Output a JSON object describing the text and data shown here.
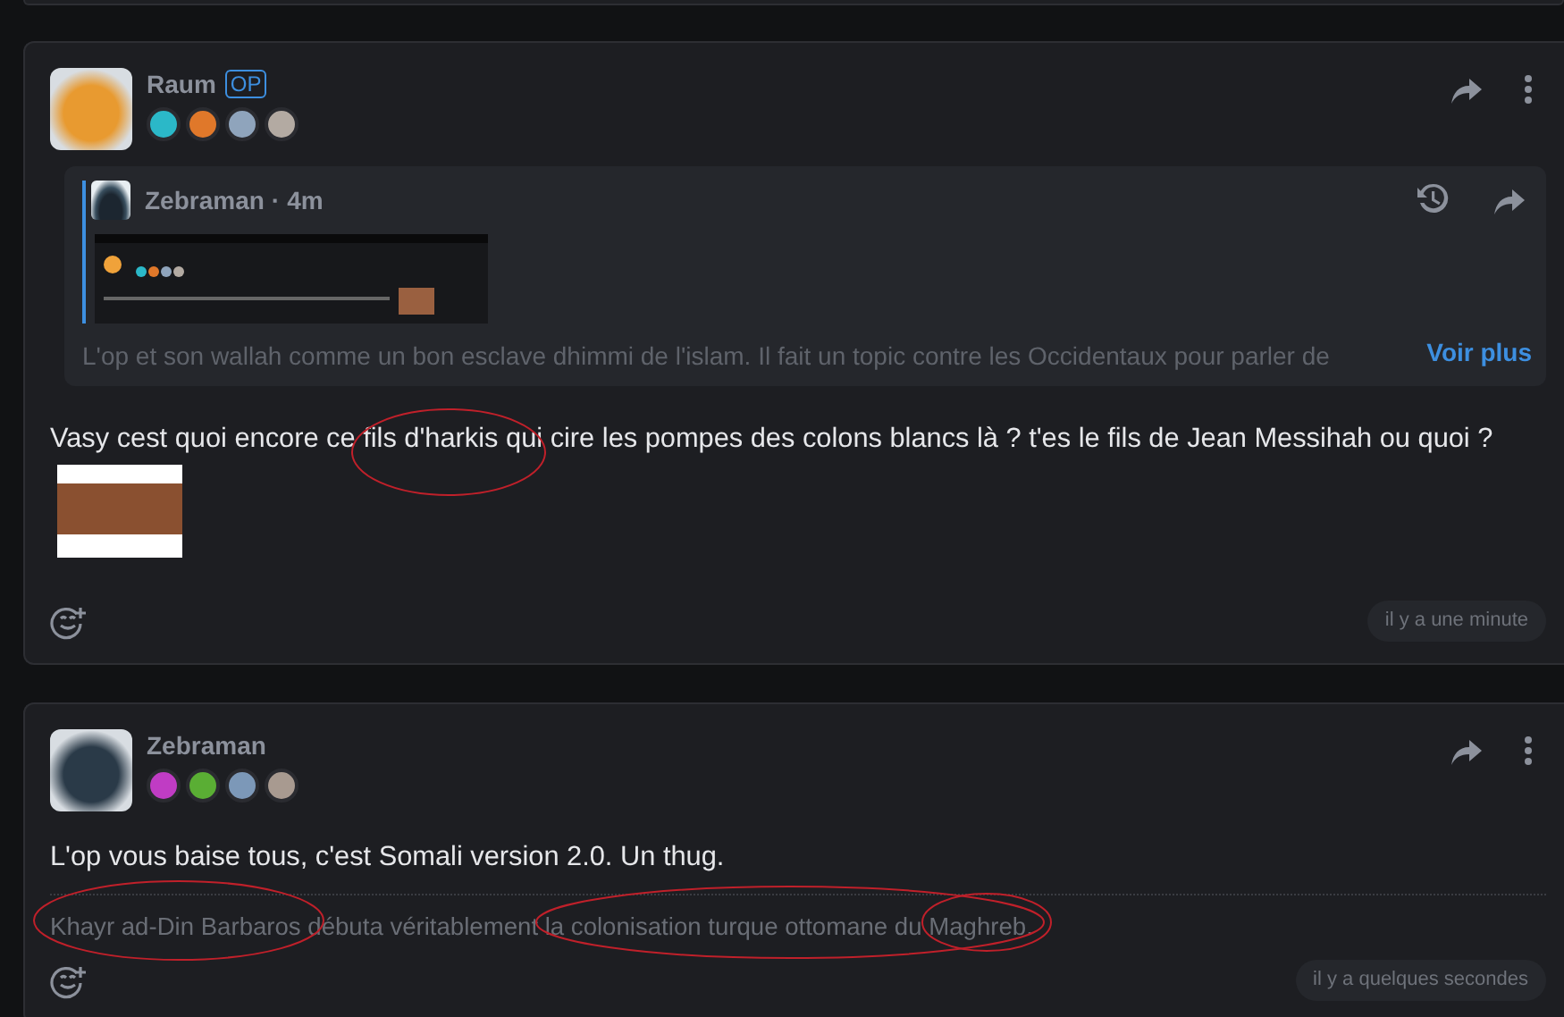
{
  "posts": [
    {
      "author": "Raum",
      "op_label": "OP",
      "avatar": {
        "color": "#e89a30"
      },
      "badges": [
        {
          "color": "#2bb8c8"
        },
        {
          "color": "#e0782a"
        },
        {
          "color": "#8fa4bc"
        },
        {
          "color": "#b3aaa2"
        }
      ],
      "quote": {
        "author": "Zebraman",
        "separator": "·",
        "age": "4m",
        "excerpt": "L'op et son wallah comme un bon esclave dhimmi de l'islam. Il fait un topic contre les Occidentaux pour parler de",
        "more": "Voir plus"
      },
      "text": "Vasy cest quoi encore ce fils d'harkis qui cire les pompes des colons blancs là ? t'es le fils de Jean Messihah ou quoi ?",
      "attachments": [
        {
          "kind": "photo"
        }
      ],
      "time": "il y a une minute"
    },
    {
      "author": "Zebraman",
      "avatar": {
        "color": "#2a3a48"
      },
      "badges": [
        {
          "color": "#c03cc4"
        },
        {
          "color": "#5aae34"
        },
        {
          "color": "#7c98b8"
        },
        {
          "color": "#a89a90"
        }
      ],
      "text": "L'op vous baise tous, c'est Somali version 2.0. Un thug.",
      "signature": "Khayr ad-Din Barbaros débuta véritablement la colonisation turque ottomane du Maghreb.",
      "time": "il y a quelques secondes"
    }
  ]
}
